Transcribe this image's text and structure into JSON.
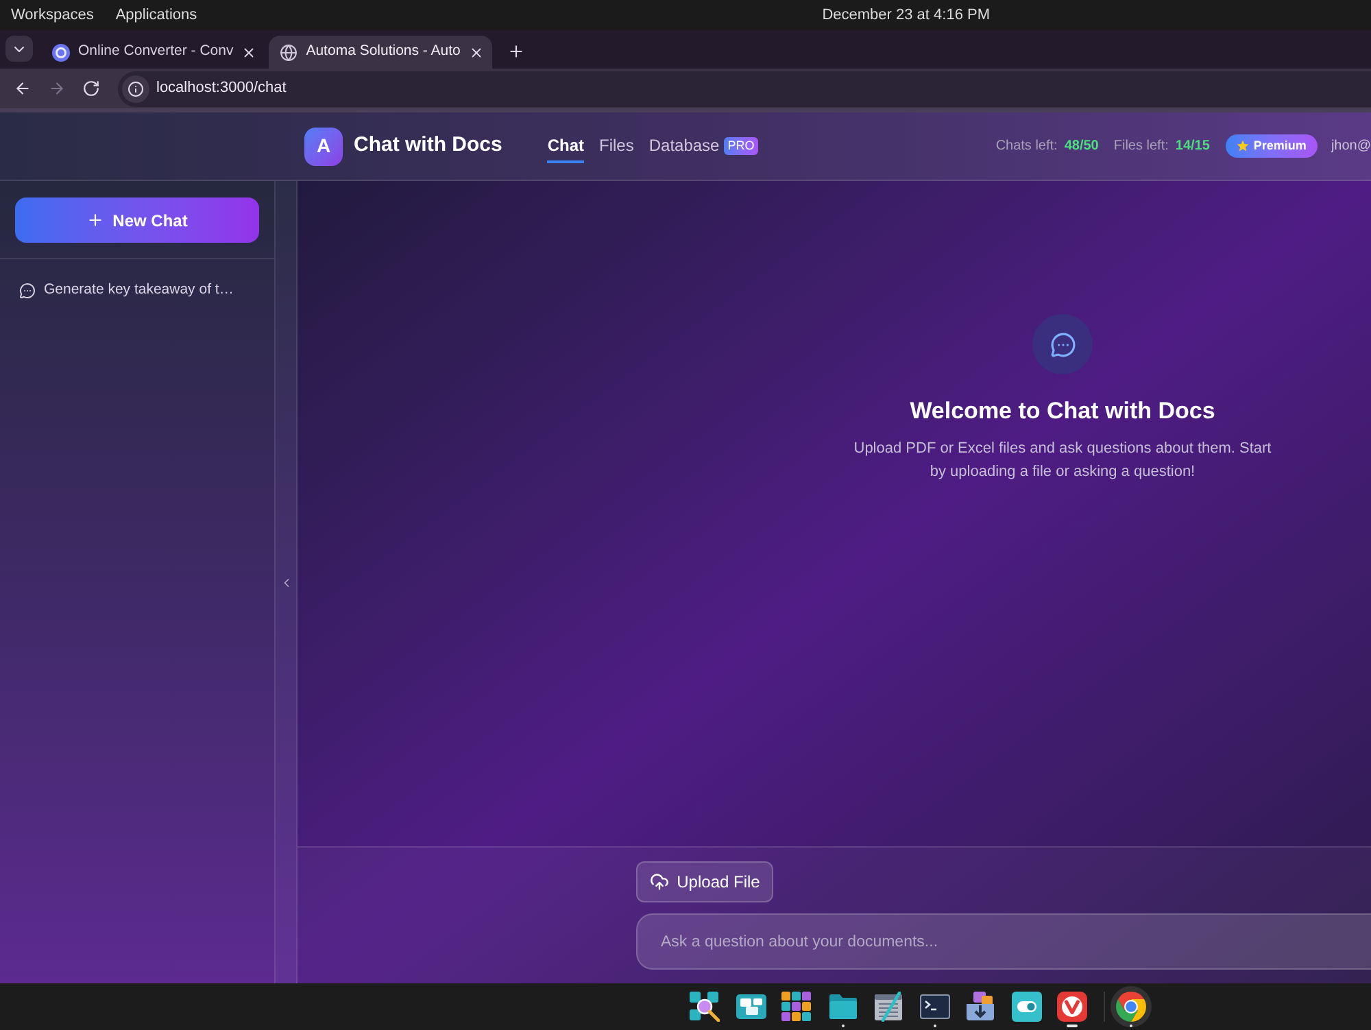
{
  "system_bar": {
    "menus": [
      "Workspaces",
      "Applications"
    ],
    "clock": "December 23 at 4:16 PM"
  },
  "browser": {
    "tabs": [
      {
        "title": "Online Converter - Conv",
        "kind": "logo",
        "selected": false
      },
      {
        "title": "Automa Solutions - Auto",
        "kind": "globe",
        "selected": true
      }
    ],
    "nav_buttons": [
      {
        "kind": "back",
        "disabled": false
      },
      {
        "kind": "forward",
        "disabled": true
      },
      {
        "kind": "reload",
        "disabled": false
      }
    ],
    "address": "localhost:3000/chat"
  },
  "header": {
    "logo": "A",
    "title": "Chat with Docs",
    "nav": [
      {
        "label": "Chat",
        "selected": true
      },
      {
        "label": "Files",
        "selected": false
      },
      {
        "label": "Database",
        "badge": "PRO",
        "selected": false
      }
    ],
    "stats": [
      {
        "label": "Chats left:",
        "value": "48/50"
      },
      {
        "label": "Files left:",
        "value": "14/15"
      }
    ],
    "plan": "Premium",
    "user": "jhon@"
  },
  "sidebar": {
    "new_chat": "New Chat",
    "chats": [
      {
        "title": "Generate key takeaway of t…"
      }
    ]
  },
  "welcome": {
    "title": "Welcome to Chat with Docs",
    "text": "Upload PDF or Excel files and ask questions about them. Start by uploading a file or asking a question!"
  },
  "composer": {
    "upload": "Upload File",
    "placeholder": "Ask a question about your documents..."
  },
  "taskbar": [
    {
      "kind": "search",
      "running": false,
      "focused": false,
      "hovered": false
    },
    {
      "kind": "windows",
      "running": false,
      "focused": false,
      "hovered": false
    },
    {
      "kind": "grid",
      "running": false,
      "focused": false,
      "hovered": false
    },
    {
      "kind": "folder",
      "running": true,
      "focused": false,
      "hovered": false
    },
    {
      "kind": "editor",
      "running": false,
      "focused": false,
      "hovered": false
    },
    {
      "kind": "terminal",
      "running": true,
      "focused": false,
      "hovered": false
    },
    {
      "kind": "package",
      "running": false,
      "focused": false,
      "hovered": false
    },
    {
      "kind": "toggle",
      "running": false,
      "focused": false,
      "hovered": false
    },
    {
      "kind": "vlogo",
      "running": true,
      "focused": true,
      "hovered": false
    },
    {
      "kind": "wheel",
      "running": true,
      "focused": false,
      "hovered": true
    }
  ]
}
